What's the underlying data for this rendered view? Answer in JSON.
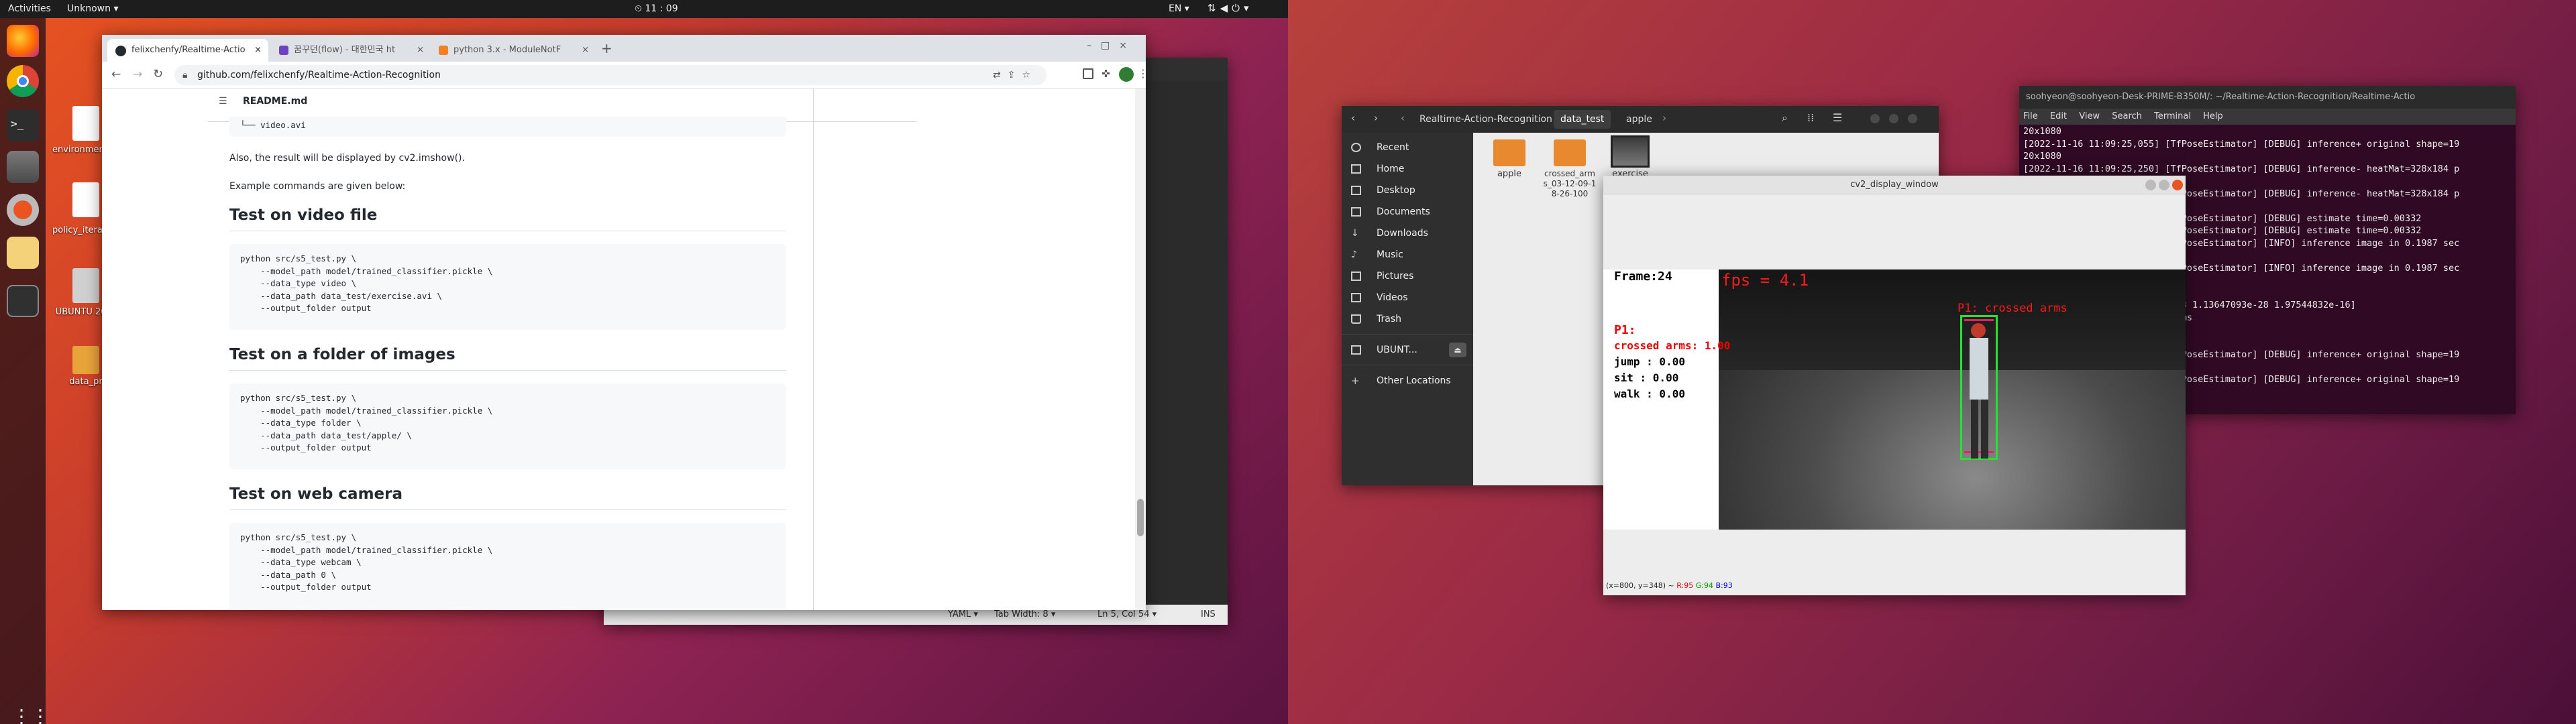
{
  "topbar": {
    "activities": "Activities",
    "app_menu": "Unknown",
    "clock": "11 : 09",
    "lang": "EN"
  },
  "desktop_icons": [
    {
      "label": "environment.pdf"
    },
    {
      "label": "policy_iteration.pdf"
    },
    {
      "label": "UBUNTU 20_0"
    },
    {
      "label": "data_pr"
    }
  ],
  "browser": {
    "tabs": [
      {
        "label": "felixchenfy/Realtime-Actio"
      },
      {
        "label": "꿈꾸던(flow) - 대한민국 ht"
      },
      {
        "label": "python 3.x - ModuleNotF"
      }
    ],
    "url": "github.com/felixchenfy/Realtime-Action-Recognition",
    "file_title": "README.md",
    "top_code": "└── video.avi",
    "para1": "Also, the result will be displayed by cv2.imshow().",
    "para2": "Example commands are given below:",
    "sections": [
      {
        "title": "Test on video file",
        "code": [
          "python src/s5_test.py \\",
          "    --model_path model/trained_classifier.pickle \\",
          "    --data_type video \\",
          "    --data_path data_test/exercise.avi \\",
          "    --output_folder output"
        ]
      },
      {
        "title": "Test on a folder of images",
        "code": [
          "python src/s5_test.py \\",
          "    --model_path model/trained_classifier.pickle \\",
          "    --data_type folder \\",
          "    --data_path data_test/apple/ \\",
          "    --output_folder output"
        ]
      },
      {
        "title": "Test on web camera",
        "code": [
          "python src/s5_test.py \\",
          "    --model_path model/trained_classifier.pickle \\",
          "    --data_type webcam \\",
          "    --data_path 0 \\",
          "    --output_folder output"
        ]
      }
    ]
  },
  "editor_status": {
    "lang": "YAML",
    "tab": "Tab Width: 8",
    "pos": "Ln 5, Col 54",
    "mode": "INS"
  },
  "files": {
    "path": [
      "Realtime-Action-Recognition",
      "data_test",
      "apple"
    ],
    "sidebar": [
      "Recent",
      "Home",
      "Desktop",
      "Documents",
      "Downloads",
      "Music",
      "Pictures",
      "Videos",
      "Trash",
      "UBUNT...",
      "Other Locations"
    ],
    "items": [
      {
        "label": "apple"
      },
      {
        "label": "crossed_arms_03-12-09-18-26-100"
      },
      {
        "label": "exercise"
      }
    ]
  },
  "cv2": {
    "title": "cv2_display_window",
    "frame": "Frame:24",
    "p_label": "P1:",
    "scores": [
      "crossed arms: 1.00",
      "jump  : 0.00",
      "sit   : 0.00",
      "walk : 0.00"
    ],
    "fps": "fps = 4.1",
    "detect": "P1: crossed arms",
    "status_pos": "(x=800, y=348) ~",
    "status_r": "R:95",
    "status_g": "G:94",
    "status_b": "B:93"
  },
  "terminal": {
    "title": "soohyeon@soohyeon-Desk-PRIME-B350M/: ~/Realtime-Action-Recognition/Realtime-Actio",
    "menu": [
      "File",
      "Edit",
      "View",
      "Search",
      "Terminal",
      "Help"
    ],
    "lines": [
      "20x1080",
      "[2022-11-16 11:09:25,055] [TfPoseEstimator] [DEBUG] inference+ original shape=19",
      "20x1080",
      "[2022-11-16 11:09:25,250] [TfPoseEstimator] [DEBUG] inference- heatMat=328x184 p",
      "",
      "                          [TfPoseEstimator] [DEBUG] inference- heatMat=328x184 p",
      "",
      "                          [TfPoseEstimator] [DEBUG] estimate time=0.00332",
      "                          [TfPoseEstimator] [DEBUG] estimate time=0.00332",
      "                          [TfPoseEstimator] [INFO] inference image in 0.1987 sec",
      "",
      "                          [TfPoseEstimator] [INFO] inference image in 0.1987 sec",
      "",
      "",
      "                          e-13 1.13647093e-28 1.97544832e-16]",
      "                           arms",
      "",
      "",
      "                          [TfPoseEstimator] [DEBUG] inference+ original shape=19",
      "",
      "                          [TfPoseEstimator] [DEBUG] inference+ original shape=19"
    ]
  }
}
